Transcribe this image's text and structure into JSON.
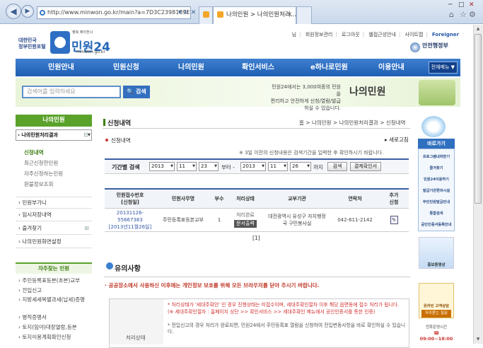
{
  "browser": {
    "url": "http://www.minwon.go.kr/main?a=7D3C2398189E0",
    "tab_active": "나의민원 > 나의민원처리...",
    "back_icon": "back-arrow-icon",
    "forward_icon": "forward-arrow-icon"
  },
  "header": {
    "gov_label_1": "대한민국",
    "gov_label_2": "정부민원포털",
    "logo_small": "행복 에이전시",
    "logo_title": "민원24",
    "logo_domain": "minwon.go.kr",
    "top_links": [
      "님",
      "회원정보관리",
      "로그아웃",
      "웹접근성안내",
      "사이트맵",
      "Foreigner"
    ],
    "ministry": "안전행정부"
  },
  "gnb": {
    "items": [
      "민원안내",
      "민원신청",
      "나의민원",
      "확인서비스",
      "e하나로민원",
      "이용안내"
    ],
    "all_menu": "전체메뉴 ▼"
  },
  "search": {
    "placeholder": "검색어를 입력하세요",
    "button": "검색",
    "promo_line1": "민원24에서는 3,000여종의 민원을",
    "promo_line2": "편리하고 안전하게 신청/열람/발급 하실 수 있습니다.",
    "promo_title": "나의민원"
  },
  "lnb": {
    "title": "나의민원",
    "items": [
      {
        "label": "나의민원처리결과",
        "selected": true
      },
      {
        "label": "민원부가니"
      },
      {
        "label": "임시저장내역"
      },
      {
        "label": "즐겨찾기"
      },
      {
        "label": "나의민원화면설정"
      }
    ],
    "sub_items": [
      "신청내역",
      "최근신청한민원",
      "자주신청하는민원",
      "환불정보조회"
    ],
    "freq_title": "자주찾는 민원",
    "freq_items": [
      "주민등록표등본(초본)교부",
      "전입신고",
      "지방세세목별과세(납세)증명",
      "병적증명서",
      "토지(임야)대장열람,등본",
      "토지이용계획확인신청"
    ]
  },
  "content": {
    "page_title": "신청내역",
    "breadcrumb": "홈 > 나의민원 > 나의민원처리결과 > 신청내역",
    "section_title": "신청내역",
    "refresh": "새로고침",
    "note": "※ 3일 이전의 신청내용은 검색기간을 입력한 후 확인하시기 바랍니다.",
    "filter": {
      "label": "기간별 검색",
      "from_year": "2013",
      "from_month": "11",
      "from_day": "23",
      "between": "부터 -",
      "to_year": "2013",
      "to_month": "11",
      "to_day": "26",
      "until": "까지",
      "search_btn": "검색",
      "all_btn": "결제확인서"
    },
    "table": {
      "headers": [
        "민원접수번호\n[신청일]",
        "민원사무명",
        "부수",
        "처리상태",
        "교부기관",
        "연락처",
        "추가\n신청"
      ],
      "rows": [
        {
          "receipt_no": "20131126-55667383",
          "date": "[2013년11월26일]",
          "name": "주민등록표등본교부",
          "copies": "1",
          "status": "처리완료",
          "doc_btn": "문서출력",
          "agency": "대전광역시 유성구 자치행정국 구민봉사실",
          "contact": "042-611-2142"
        }
      ]
    },
    "pager": "[1]",
    "caution_title": "유의사항",
    "warning": "· 공공장소에서 사용하신 이후에는 개인정보 보호를 위해 모든 브라우저를 닫아 주시기 바랍니다.",
    "box_left": "처리상태",
    "box_lines": [
      "* 처리상태가 '세대주확인' 인 경우 진행상태는 미접수이며, 세대주확인절차 이후 해당 읍면동에 접수 처리가 됩니다.",
      "(※ 세대주확인절차 : 홈페이지 상단 >> 확인서비스 >> 세대주확인 메뉴에서 공인인증서를 통한 인증)",
      "* 전입신고의 경우 처리가 완료되면, 민원24에서 주민등록표 열람을 신청하여 전입변동사항을 바로 확인하실 수 있습니다."
    ]
  },
  "right_quick": {
    "head": "바로가기",
    "items": [
      "프로그램내려받기",
      "즐겨찾기",
      "민원24이용하기",
      "발급기관편의시설",
      "무인민원발급안내",
      "통합검색",
      "공인인증서등록안내"
    ],
    "video": "홍보동영상",
    "cs_title": "온라인 고객상담",
    "cs_btn": "자주묻는 질문",
    "hours_label": "전화운영시간",
    "hours": "09:00~18:00"
  }
}
